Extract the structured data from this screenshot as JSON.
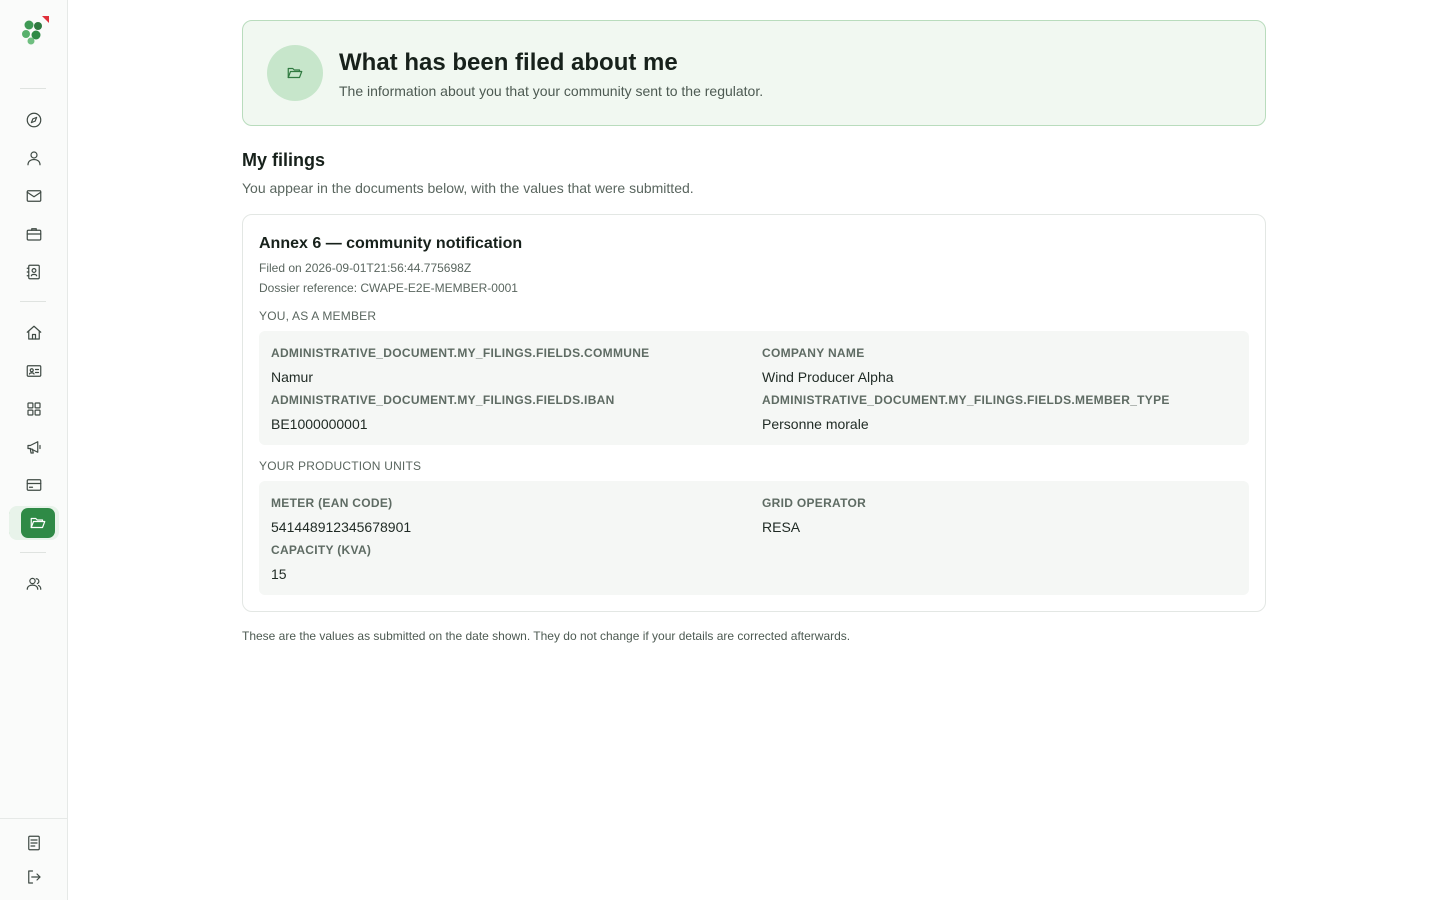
{
  "sidebar": {
    "logo_icon": "clover-logo",
    "nav": [
      {
        "icon": "compass-icon"
      },
      {
        "icon": "user-icon"
      },
      {
        "icon": "mail-icon"
      },
      {
        "icon": "briefcase-icon"
      },
      {
        "icon": "contact-book-icon"
      },
      {
        "icon": "home-icon"
      },
      {
        "icon": "id-card-icon"
      },
      {
        "icon": "grid-icon"
      },
      {
        "icon": "megaphone-icon"
      },
      {
        "icon": "credit-card-icon"
      },
      {
        "icon": "folder-open-icon",
        "active": true
      },
      {
        "icon": "users-icon"
      },
      {
        "icon": "document-icon"
      },
      {
        "icon": "logout-icon"
      }
    ],
    "accent_color": "#2f8a46"
  },
  "hero": {
    "title": "What has been filed about me",
    "subtitle": "The information about you that your community sent to the regulator.",
    "icon": "folder-open-icon"
  },
  "filings": {
    "title": "My filings",
    "subtitle": "You appear in the documents below, with the values that were submitted.",
    "documents": [
      {
        "title": "Annex 6 — community notification",
        "filed_on": "Filed on 2026-09-01T21:56:44.775698Z",
        "dossier": "Dossier reference: CWAPE-E2E-MEMBER-0001",
        "member_section": {
          "label": "You, as a member",
          "fields": [
            {
              "label": "ADMINISTRATIVE_DOCUMENT.MY_FILINGS.FIELDS.COMMUNE",
              "value": "Namur"
            },
            {
              "label": "Company name",
              "value": "Wind Producer Alpha"
            },
            {
              "label": "ADMINISTRATIVE_DOCUMENT.MY_FILINGS.FIELDS.IBAN",
              "value": "BE1000000001"
            },
            {
              "label": "ADMINISTRATIVE_DOCUMENT.MY_FILINGS.FIELDS.MEMBER_TYPE",
              "value": "Personne morale"
            }
          ]
        },
        "units_section": {
          "label": "Your production units",
          "fields": [
            {
              "label": "Meter (EAN code)",
              "value": "541448912345678901"
            },
            {
              "label": "Grid operator",
              "value": "RESA"
            },
            {
              "label": "Capacity (kVA)",
              "value": "15"
            }
          ]
        }
      }
    ],
    "footnote": "These are the values as submitted on the date shown. They do not change if your details are corrected afterwards."
  }
}
